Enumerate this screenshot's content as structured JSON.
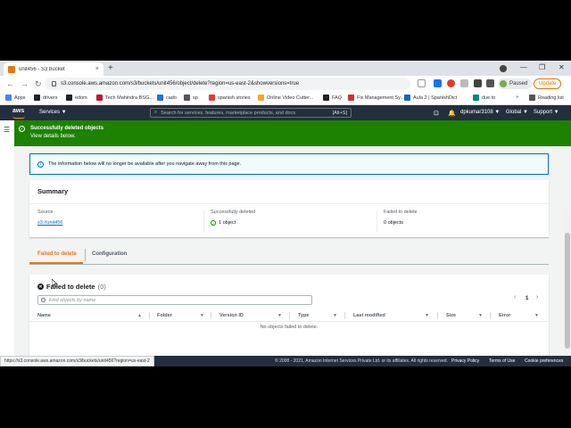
{
  "browser": {
    "tab_title": "unit456 - S3 bucket",
    "tab_close": "×",
    "new_tab": "+",
    "back": "←",
    "forward": "→",
    "reload": "↻",
    "url": "s3.console.aws.amazon.com/s3/buckets/unit456/object/delete?region=us-east-2&showversions=true",
    "profile_status": "Paused",
    "update_label": "Update",
    "minimize": "—",
    "restore": "❐",
    "close": "✕",
    "status_url": "https://s3.console.aws.amazon.com/s3/buckets/unit456?region=us-east-2"
  },
  "bookmarks": [
    {
      "label": "Apps",
      "color": "#4285f4"
    },
    {
      "label": "drivers",
      "color": "#222222"
    },
    {
      "label": "edom",
      "color": "#222222"
    },
    {
      "label": "Tech Mahindra BSG...",
      "color": "#c41230"
    },
    {
      "label": "cado",
      "color": "#1a73e8"
    },
    {
      "label": "sp",
      "color": "#555555"
    },
    {
      "label": "spanish stories",
      "color": "#e53935"
    },
    {
      "label": "Online Video Cutter...",
      "color": "#f9a825"
    },
    {
      "label": "FAQ",
      "color": "#222222"
    },
    {
      "label": "Fix Management Sy...",
      "color": "#d32f2f"
    },
    {
      "label": "Aula 2 | SpanishDict",
      "color": "#1565c0"
    },
    {
      "label": "due to",
      "color": "#00897b"
    },
    {
      "label": "»",
      "color": ""
    },
    {
      "label": "Reading list",
      "color": "#555555"
    }
  ],
  "aws_nav": {
    "logo": "aws",
    "services": "Services ▼",
    "search_placeholder": "Search for services, features, marketplace products, and docs",
    "search_hint": "[Alt+S]",
    "account": "dpkumar3108 ▼",
    "region": "Global ▼",
    "support": "Support ▼"
  },
  "flash": {
    "title": "Successfully deleted objects",
    "subtitle": "View details below."
  },
  "info_text": "The information below will no longer be available after you navigate away from this page.",
  "summary": {
    "heading": "Summary",
    "source_label": "Source",
    "source_value": "s3://unit456",
    "deleted_label": "Successfully deleted",
    "deleted_value": "1 object",
    "failed_label": "Failed to delete",
    "failed_value": "0 objects"
  },
  "tabs": [
    {
      "label": "Failed to delete",
      "active": true
    },
    {
      "label": "Configuration",
      "active": false
    }
  ],
  "failed_panel": {
    "heading": "Failed to delete",
    "count": "(0)",
    "find_placeholder": "Find objects by name",
    "page_number": "1",
    "prev": "‹",
    "next": "›",
    "columns": [
      "Name",
      "Folder",
      "Version ID",
      "Type",
      "Last modified",
      "Size",
      "Error"
    ],
    "empty_text": "No objects failed to delete."
  },
  "footer": {
    "copyright": "© 2008 - 2021, Amazon Internet Services Private Ltd. or its affiliates. All rights reserved.",
    "privacy": "Privacy Policy",
    "terms": "Terms of Use",
    "cookies": "Cookie preferences"
  },
  "colors": {
    "aws_dark": "#232f3e",
    "success_green": "#1d8102",
    "accent_orange": "#ec7211",
    "link_blue": "#0073bb"
  }
}
